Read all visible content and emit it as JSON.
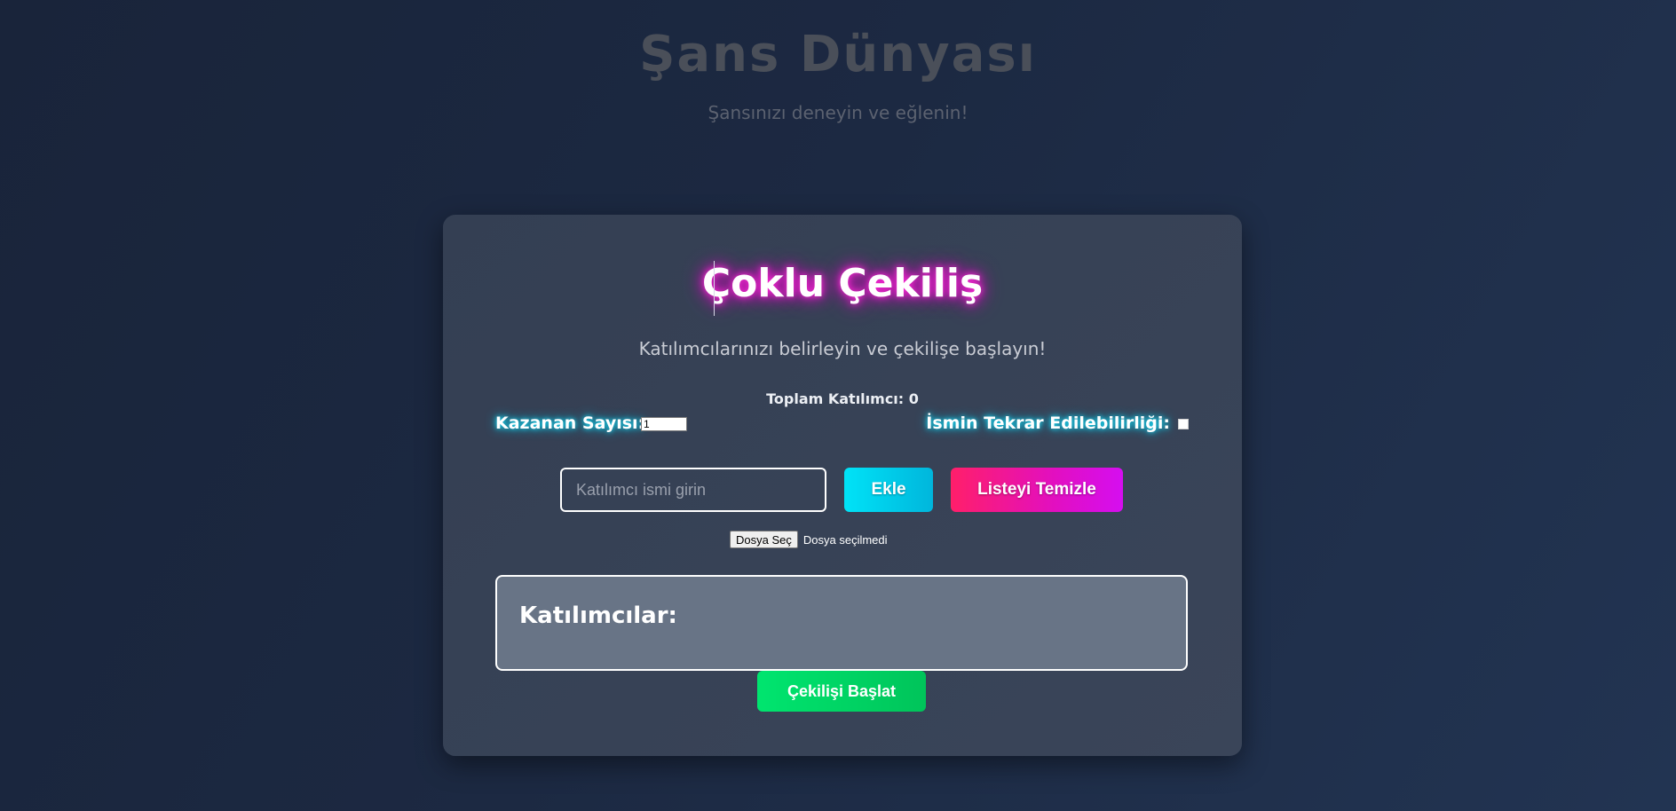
{
  "site": {
    "title": "Şans Dünyası",
    "subtitle": "Şansınızı deneyin ve eğlenin!"
  },
  "card": {
    "title": "Çoklu Çekiliş",
    "subtitle": "Katılımcılarınızı belirleyin ve çekilişe başlayın!",
    "total_participants": "Toplam Katılımcı: 0",
    "winner_count_label": "Kazanan Sayısı:",
    "winner_count_value": "1",
    "repeat_label": "İsmin Tekrar Edilebilirliği:",
    "repeat_checked": false,
    "name_input_placeholder": "Katılımcı ismi girin",
    "name_input_value": "",
    "add_button": "Ekle",
    "clear_button": "Listeyi Temizle",
    "file_button": "Dosya Seç",
    "file_status": "Dosya seçilmedi",
    "participants_heading": "Katılımcılar:",
    "participants": [],
    "start_button": "Çekilişi Başlat"
  },
  "colors": {
    "background": "#1c2942",
    "card": "#384357",
    "title_glow": "#ff2bd6",
    "label_glow": "#19e6ff",
    "add_button": "#00d3ee",
    "clear_button_start": "#ff1f6a",
    "clear_button_end": "#d50ef0",
    "start_button": "#00d765"
  },
  "icons": {
    "repeat_toggle": "checkbox-icon"
  }
}
